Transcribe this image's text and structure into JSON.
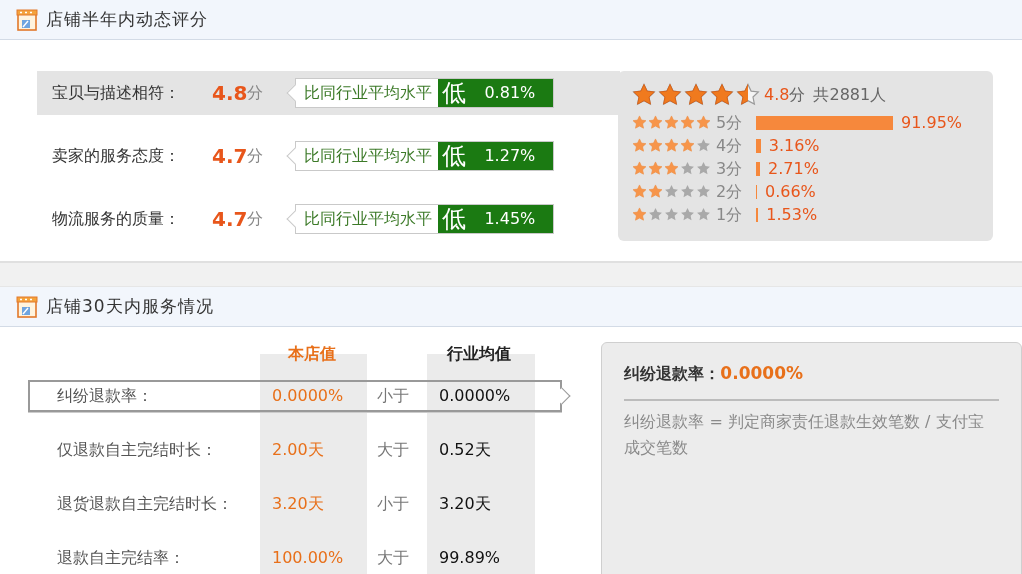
{
  "rating_section": {
    "title": "店铺半年内动态评分",
    "scores": [
      {
        "label": "宝贝与描述相符：",
        "score": "4.8",
        "unit": "分",
        "selected": true,
        "compare_label": "比同行业平均水平",
        "compare_result": "低",
        "compare_value": "0.81%"
      },
      {
        "label": "卖家的服务态度：",
        "score": "4.7",
        "unit": "分",
        "selected": false,
        "compare_label": "比同行业平均水平",
        "compare_result": "低",
        "compare_value": "1.27%"
      },
      {
        "label": "物流服务的质量：",
        "score": "4.7",
        "unit": "分",
        "selected": false,
        "compare_label": "比同行业平均水平",
        "compare_result": "低",
        "compare_value": "1.45%"
      }
    ],
    "summary": {
      "stars": 4.5,
      "score": "4.8",
      "unit": "分",
      "count_text": "共2881人",
      "distribution": [
        {
          "stars": 5,
          "label": "5分",
          "percent": "91.95%"
        },
        {
          "stars": 4,
          "label": "4分",
          "percent": "3.16%"
        },
        {
          "stars": 3,
          "label": "3分",
          "percent": "2.71%"
        },
        {
          "stars": 2,
          "label": "2分",
          "percent": "0.66%"
        },
        {
          "stars": 1,
          "label": "1分",
          "percent": "1.53%"
        }
      ]
    }
  },
  "service_section": {
    "title": "店铺30天内服务情况",
    "columns": [
      "本店值",
      "行业均值"
    ],
    "rows": [
      {
        "label": "纠纷退款率：",
        "store_value": "0.0000%",
        "comparison": "小于",
        "industry_value": "0.0000%",
        "selected": true
      },
      {
        "label": "仅退款自主完结时长：",
        "store_value": "2.00天",
        "comparison": "大于",
        "industry_value": "0.52天",
        "selected": false
      },
      {
        "label": "退货退款自主完结时长：",
        "store_value": "3.20天",
        "comparison": "小于",
        "industry_value": "3.20天",
        "selected": false
      },
      {
        "label": "退款自主完结率：",
        "store_value": "100.00%",
        "comparison": "大于",
        "industry_value": "99.89%",
        "selected": false
      }
    ],
    "detail": {
      "title": "纠纷退款率：",
      "value": "0.0000%",
      "description": "纠纷退款率 = 判定商家责任退款生效笔数 / 支付宝成交笔数"
    }
  }
}
